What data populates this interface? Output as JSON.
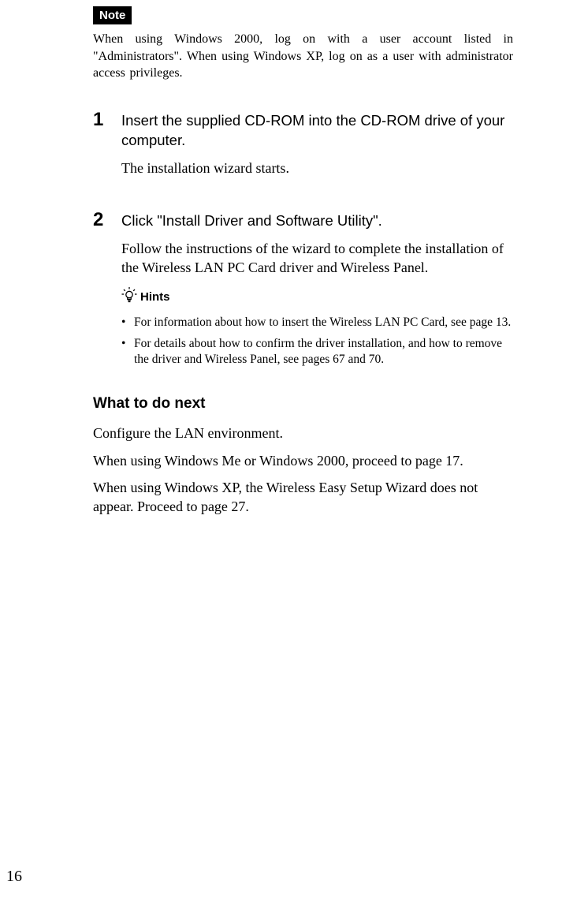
{
  "note": {
    "badge": "Note",
    "text": "When using Windows 2000, log on with a user account listed in \"Administrators\". When using Windows XP, log on as a user with administrator access privileges."
  },
  "steps": [
    {
      "num": "1",
      "title": "Insert the supplied CD-ROM into the CD-ROM drive of your computer.",
      "desc": "The installation wizard starts."
    },
    {
      "num": "2",
      "title": "Click \"Install Driver and Software Utility\".",
      "desc": "Follow the instructions of the wizard to complete the installation of the Wireless LAN PC Card driver and Wireless Panel."
    }
  ],
  "hints": {
    "label": "Hints",
    "items": [
      "For information about how to insert the Wireless LAN PC Card, see page 13.",
      "For details about how to confirm the driver installation, and how to remove the driver and Wireless Panel, see pages 67 and 70."
    ]
  },
  "next": {
    "heading": "What to do next",
    "p1": "Configure the LAN environment.",
    "p2": "When using Windows Me or Windows 2000, proceed to page 17.",
    "p3": "When using Windows XP, the Wireless Easy Setup Wizard does not appear. Proceed to page 27."
  },
  "pageNumber": "16"
}
